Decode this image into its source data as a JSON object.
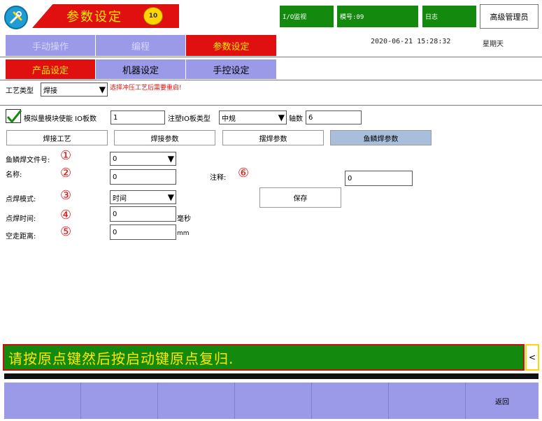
{
  "header": {
    "title": "参数设定",
    "badge": "10",
    "io_monitor": "I/O监视",
    "mold_no": "模号:09",
    "log": "日志",
    "admin": "高级管理员",
    "datetime": "2020-06-21  15:28:32",
    "weekday": "星期天"
  },
  "menu": {
    "manual": "手动操作",
    "program": "编程",
    "param": "参数设定"
  },
  "tabs": {
    "product": "产品设定",
    "machine": "机器设定",
    "handctrl": "手控设定"
  },
  "process": {
    "label": "工艺类型",
    "value": "焊接",
    "warning": "选择冲压工艺后需要重启!"
  },
  "module": {
    "enable_label": "模拟量模块使能 IO板数",
    "io_count": "1",
    "inj_label": "注塑IO板类型",
    "inj_value": "中规",
    "axis_label": "轴数",
    "axis_value": "6"
  },
  "subtabs": {
    "weld_proc": "焊接工艺",
    "weld_param": "焊接参数",
    "swing": "摆焊参数",
    "fish": "鱼鳞焊参数"
  },
  "params": {
    "file_label": "鱼鳞焊文件号:",
    "file_value": "0",
    "name_label": "名称:",
    "name_value": "0",
    "note_label": "注释:",
    "note_value": "0",
    "mode_label": "点焊模式:",
    "mode_value": "时间",
    "save": "保存",
    "spot_label": "点焊时间:",
    "spot_value": "0",
    "spot_unit": "毫秒",
    "idle_label": "空走距离:",
    "idle_value": "0",
    "idle_unit": "mm",
    "c1": "①",
    "c2": "②",
    "c3": "③",
    "c4": "④",
    "c5": "⑤",
    "c6": "⑥"
  },
  "status": {
    "message": "请按原点键然后按启动键原点复归.",
    "scroll": "<"
  },
  "bottom": {
    "keys": [
      "",
      "",
      "",
      "",
      "",
      "",
      "返回"
    ]
  },
  "colors": {
    "accent_red": "#e01010",
    "accent_yellow": "#ffe600",
    "menu_blue": "#9a9ae8",
    "status_green": "#138a0e"
  }
}
